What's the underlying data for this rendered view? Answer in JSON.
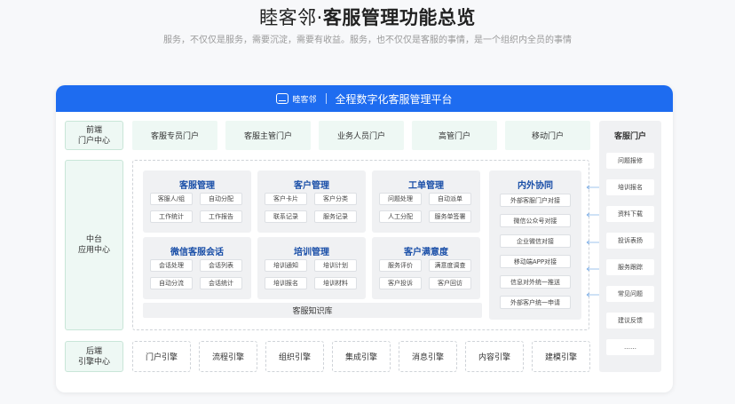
{
  "header": {
    "brand": "睦客邻",
    "dot": "·",
    "title": "客服管理功能总览",
    "subtitle": "服务，不仅仅是服务，需要沉淀，需要有收益。服务，也不仅仅是客服的事情，是一个组织内全员的事情"
  },
  "platform": {
    "logo_text": "睦客邻",
    "title": "全程数字化客服管理平台"
  },
  "rows": {
    "front": "前端\n门户中心",
    "middle": "中台\n应用中心",
    "back": "后端\n引擎中心"
  },
  "portals": [
    "客服专员门户",
    "客服主管门户",
    "业务人员门户",
    "高管门户",
    "移动门户"
  ],
  "groups": [
    {
      "title": "客服管理",
      "items": [
        "客服人/组",
        "自动分配",
        "工作统计",
        "工作报告"
      ]
    },
    {
      "title": "客户管理",
      "items": [
        "客户卡片",
        "客户分类",
        "联系记录",
        "服务记录"
      ]
    },
    {
      "title": "工单管理",
      "items": [
        "问题处理",
        "自动派单",
        "人工分配",
        "服务单签署"
      ]
    },
    {
      "title": "微信客服会话",
      "items": [
        "会话处理",
        "会话列表",
        "自动分流",
        "会话统计"
      ]
    },
    {
      "title": "培训管理",
      "items": [
        "培训通知",
        "培训计划",
        "培训报名",
        "培训材料"
      ]
    },
    {
      "title": "客户满意度",
      "items": [
        "服务评价",
        "满意度调查",
        "客户投诉",
        "客户回访"
      ]
    }
  ],
  "knowledge_base": "客服知识库",
  "collab": {
    "title": "内外协同",
    "items": [
      "外部客服门户对接",
      "微信公众号对接",
      "企业微信对接",
      "移动端APP对接",
      "信息对外统一推送",
      "外部客户统一申请"
    ]
  },
  "side_panel": {
    "title": "客服门户",
    "items": [
      "问题报修",
      "培训报名",
      "资料下载",
      "投诉表扬",
      "服务跟踪",
      "常见问题",
      "建议反馈",
      "……"
    ]
  },
  "engines": [
    "门户引擎",
    "流程引擎",
    "组织引擎",
    "集成引擎",
    "消息引擎",
    "内容引擎",
    "建模引擎"
  ],
  "colors": {
    "primary": "#1e6cf0",
    "title_text": "#1a4fa8",
    "label_bg": "#eef8f4",
    "panel_bg": "#f0f1f3"
  }
}
